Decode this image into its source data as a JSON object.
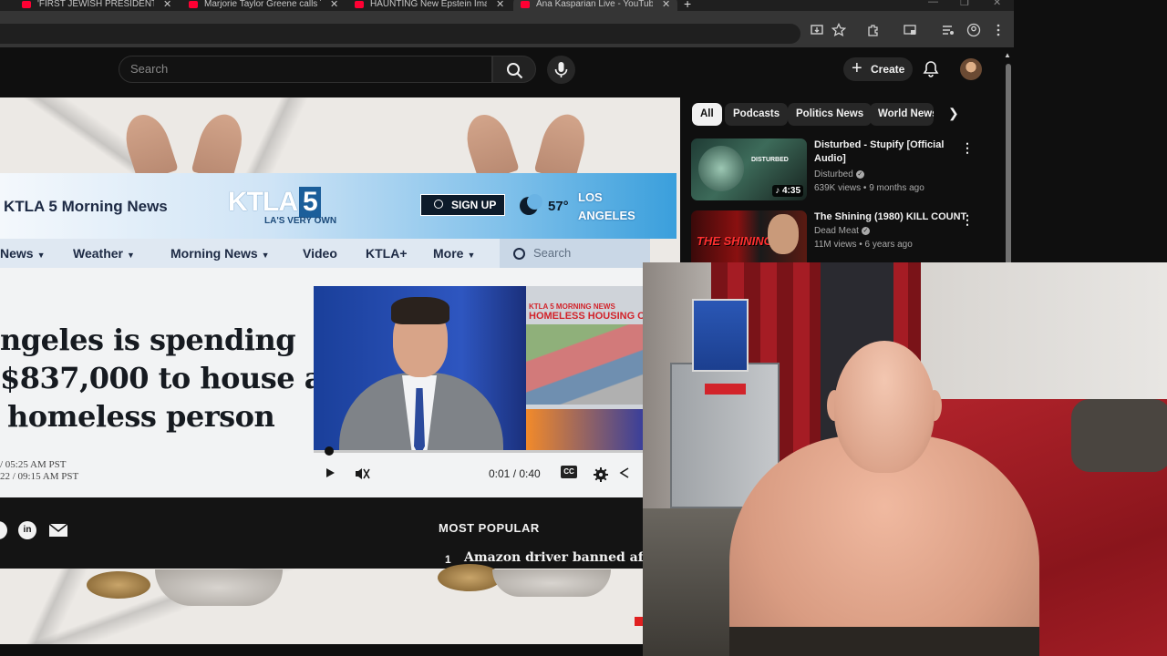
{
  "browser": {
    "tabs": [
      {
        "title": "'FIRST JEWISH PRESIDENT': Ado",
        "active": false
      },
      {
        "title": "Marjorie Taylor Greene calls Tru",
        "active": false
      },
      {
        "title": "HAUNTING New Epstein Image",
        "active": false
      },
      {
        "title": "Ana Kasparian Live - YouTube",
        "active": true
      }
    ],
    "close_glyph": "✕",
    "new_tab_glyph": "+",
    "window_controls": [
      "—",
      "❐",
      "✕"
    ]
  },
  "youtube": {
    "search": {
      "placeholder": "Search"
    },
    "create_label": "Create",
    "chips": [
      "All",
      "Podcasts",
      "Politics News",
      "World News"
    ],
    "selected_chip": "All",
    "recommendations": [
      {
        "title": "Disturbed - Stupify [Official Audio]",
        "channel": "Disturbed",
        "verified": true,
        "meta": "639K views • 9 months ago",
        "duration": "4:35",
        "thumb_caption": "DISTURBED"
      },
      {
        "title": "The Shining (1980) KILL COUNT",
        "channel": "Dead Meat",
        "verified": true,
        "meta": "11M views • 6 years ago",
        "duration": "",
        "thumb_caption": "THE SHINING"
      }
    ]
  },
  "video_content": {
    "site_title": "KTLA 5 Morning News",
    "logo_text": "KTLA",
    "logo_number": "5",
    "logo_tagline": "LA'S VERY OWN",
    "signup_label": "SIGN UP",
    "temperature": "57°",
    "city_line1": "LOS",
    "city_line2": "ANGELES",
    "nav": [
      "News",
      "Weather",
      "Morning News",
      "Video",
      "KTLA+",
      "More"
    ],
    "search_placeholder": "Search",
    "headline_lines": [
      "ngeles is spending",
      "$837,000 to house a",
      "homeless person"
    ],
    "posted": "/ 05:25 AM PST",
    "updated": "22 / 09:15 AM PST",
    "player": {
      "side_label_small": "KTLA 5 MORNING NEWS",
      "side_label": "HOMELESS HOUSING COSTS",
      "time_current": "0:01",
      "time_total": "/ 0:40",
      "cc_label": "CC"
    },
    "most_popular_label": "MOST POPULAR",
    "most_popular_num": "1",
    "most_popular_item": "Amazon driver banned afte",
    "social_linkedin": "in"
  }
}
